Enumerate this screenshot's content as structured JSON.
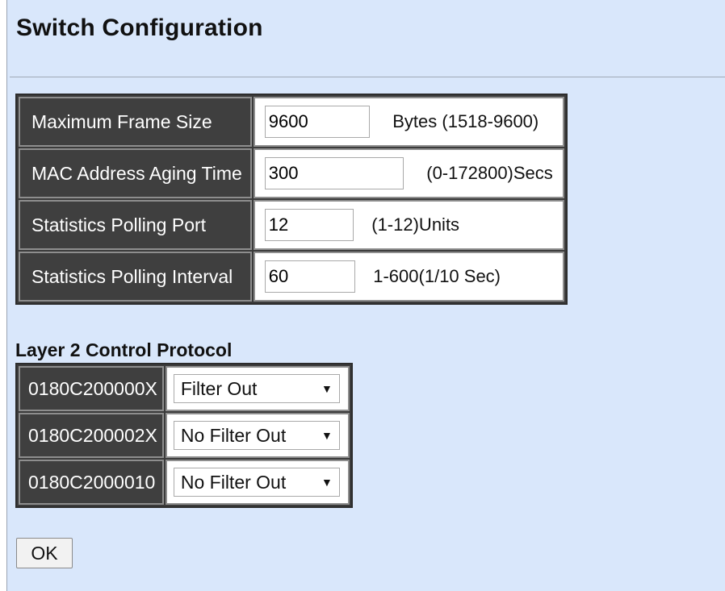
{
  "page": {
    "title": "Switch Configuration"
  },
  "config_rows": [
    {
      "label": "Maximum Frame Size",
      "value": "9600",
      "unit": "Bytes (1518-9600)"
    },
    {
      "label": "MAC Address Aging Time",
      "value": "300",
      "unit": "(0-172800)Secs"
    },
    {
      "label": "Statistics Polling Port",
      "value": "12",
      "unit": "(1-12)Units"
    },
    {
      "label": "Statistics Polling Interval",
      "value": "60",
      "unit": "1-600(1/10 Sec)"
    }
  ],
  "layer2": {
    "title": "Layer 2 Control Protocol",
    "rows": [
      {
        "label": "0180C200000X",
        "selected": "Filter Out"
      },
      {
        "label": "0180C200002X",
        "selected": "No Filter Out"
      },
      {
        "label": "0180C2000010",
        "selected": "No Filter Out"
      }
    ]
  },
  "buttons": {
    "ok": "OK"
  },
  "icons": {
    "dropdown": "dropdown-caret-icon"
  },
  "colors": {
    "background": "#d9e7fb",
    "label_cell": "#3f3f3f",
    "value_cell": "#ffffff"
  }
}
